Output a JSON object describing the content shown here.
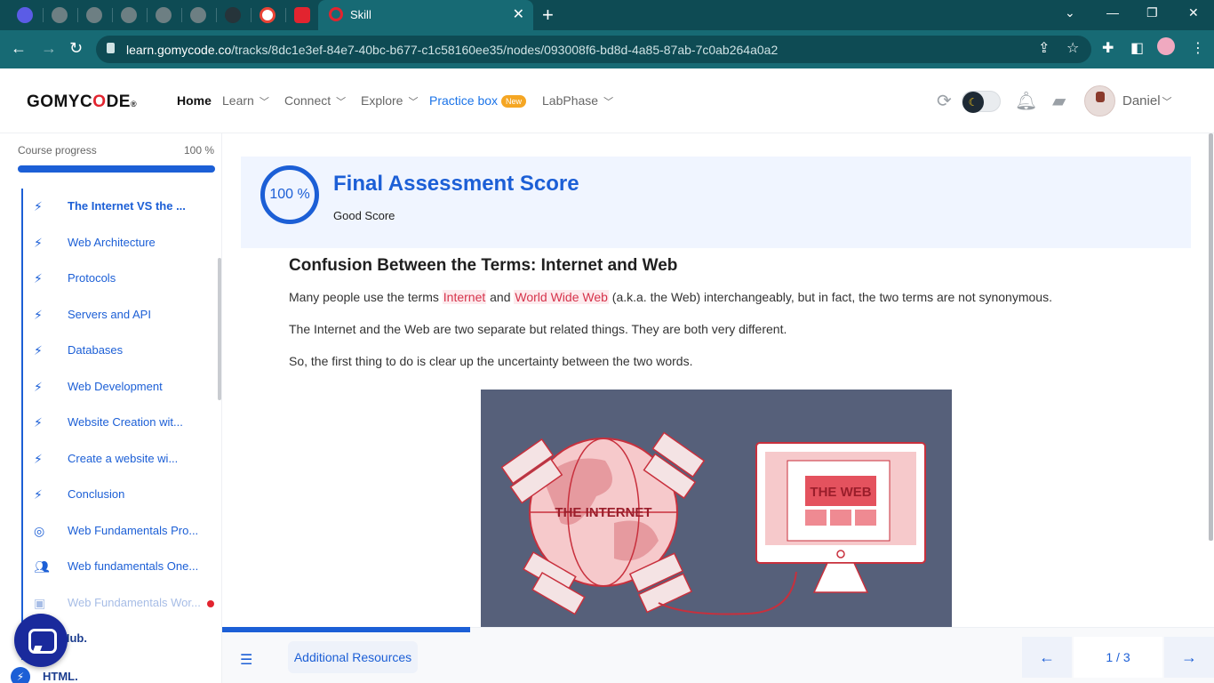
{
  "browser": {
    "active_tab_title": "Skill",
    "new_tab_symbol": "+",
    "url_host": "learn.gomycode.co",
    "url_path": "/tracks/8dc1e3ef-84e7-40bc-b677-c1c58160ee35/nodes/093008f6-bd8d-4a85-87ab-7c0ab264a0a2"
  },
  "header": {
    "logo_text_a": "GOMYC",
    "logo_text_o": "O",
    "logo_text_b": "DE",
    "logo_mark": "®",
    "nav": {
      "home": "Home",
      "learn": "Learn",
      "connect": "Connect",
      "explore": "Explore",
      "practice": "Practice box",
      "practice_badge": "New",
      "labphase": "LabPhase"
    },
    "user_name": "Daniel"
  },
  "sidebar": {
    "progress_label": "Course progress",
    "progress_value": "100 %",
    "progress_fraction": 1.0,
    "lessons": [
      {
        "label": "The Internet VS the ...",
        "icon": "bolt-icon"
      },
      {
        "label": "Web Architecture",
        "icon": "bolt-icon"
      },
      {
        "label": "Protocols",
        "icon": "bolt-icon"
      },
      {
        "label": "Servers and API",
        "icon": "bolt-icon"
      },
      {
        "label": "Databases",
        "icon": "bolt-icon"
      },
      {
        "label": "Web Development",
        "icon": "bolt-icon"
      },
      {
        "label": "Website Creation wit...",
        "icon": "bolt-icon"
      },
      {
        "label": "Create a website wi...",
        "icon": "bolt-icon"
      },
      {
        "label": "Conclusion",
        "icon": "bolt-icon"
      },
      {
        "label": "Web Fundamentals Pro...",
        "icon": "target-icon"
      },
      {
        "label": "Web fundamentals One...",
        "icon": "people-icon"
      },
      {
        "label": "Web Fundamentals Wor...",
        "icon": "workshop-icon"
      }
    ],
    "sections": [
      {
        "label": "& GitHub."
      },
      {
        "label": "HTML."
      }
    ]
  },
  "score": {
    "percent": "100 %",
    "title": "Final Assessment Score",
    "subtitle": "Good Score"
  },
  "article": {
    "title": "Confusion Between the Terms: Internet and Web",
    "p1_a": "Many people use the terms ",
    "p1_hl1": "Internet",
    "p1_b": " and ",
    "p1_hl2": "World Wide Web",
    "p1_c": " (a.k.a. the Web) interchangeably, but in fact, the two terms are not synonymous.",
    "p2": "The Internet and the Web are two separate but related things. They are both very different.",
    "p3": "So, the first thing to do is clear up the uncertainty between the two words.",
    "illustration_left": "THE INTERNET",
    "illustration_right": "THE WEB"
  },
  "bottom": {
    "resources_label": "Additional Resources",
    "page_indicator": "1 / 3"
  }
}
